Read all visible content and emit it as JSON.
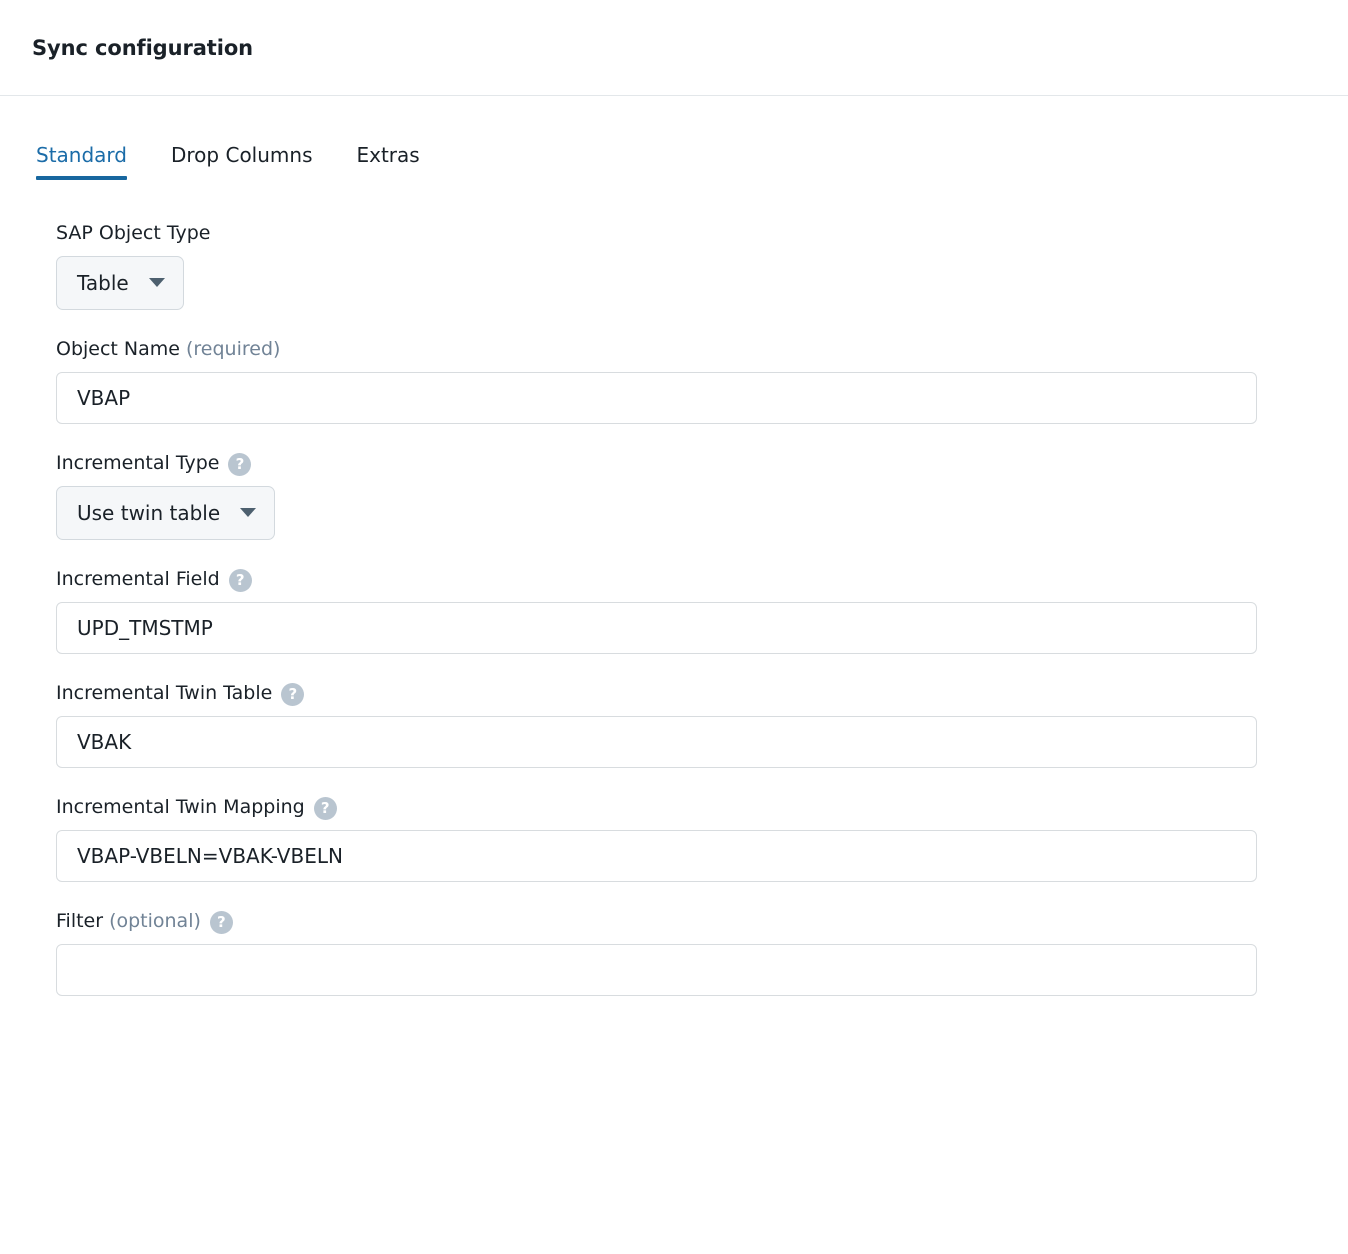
{
  "header": {
    "title": "Sync configuration"
  },
  "tabs": [
    {
      "label": "Standard",
      "active": true
    },
    {
      "label": "Drop Columns",
      "active": false
    },
    {
      "label": "Extras",
      "active": false
    }
  ],
  "colors": {
    "accent": "#17679f",
    "accent_text": "#1b6ca8",
    "text": "#1a2128",
    "muted": "#718396",
    "border": "#d8dcdf",
    "select_bg": "#f5f7f9",
    "help_icon_bg": "#b9c5d0",
    "divider": "#e3e7ea"
  },
  "form": {
    "sap_object_type": {
      "label": "SAP Object Type",
      "value": "Table",
      "help_icon": null
    },
    "object_name": {
      "label": "Object Name",
      "suffix": "(required)",
      "value": "VBAP",
      "placeholder": ""
    },
    "incremental_type": {
      "label": "Incremental Type",
      "value": "Use twin table",
      "help_icon": "question-mark-icon"
    },
    "incremental_field": {
      "label": "Incremental Field",
      "value": "UPD_TMSTMP",
      "placeholder": "",
      "help_icon": "question-mark-icon"
    },
    "incremental_twin_table": {
      "label": "Incremental Twin Table",
      "value": "VBAK",
      "placeholder": "",
      "help_icon": "question-mark-icon"
    },
    "incremental_twin_mapping": {
      "label": "Incremental Twin Mapping",
      "value": "VBAP-VBELN=VBAK-VBELN",
      "placeholder": "",
      "help_icon": "question-mark-icon"
    },
    "filter": {
      "label": "Filter",
      "suffix": "(optional)",
      "value": "",
      "placeholder": "",
      "help_icon": "question-mark-icon"
    }
  },
  "icons": {
    "help": "?",
    "chevron_down": "chevron-down-icon"
  }
}
